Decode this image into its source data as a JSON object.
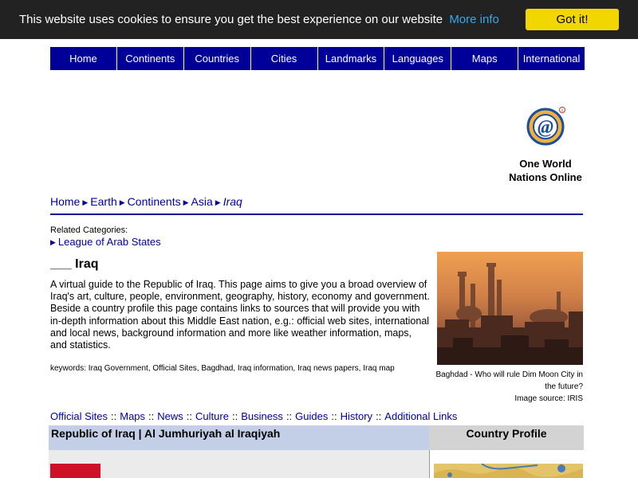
{
  "cookie": {
    "message": "This website uses cookies to ensure you get the best experience on our website",
    "more_info": "More info",
    "button": "Got it!"
  },
  "nav": [
    {
      "label": "Home"
    },
    {
      "label": "Continents"
    },
    {
      "label": "Countries"
    },
    {
      "label": "Cities"
    },
    {
      "label": "Landmarks"
    },
    {
      "label": "Languages"
    },
    {
      "label": "Maps"
    },
    {
      "label": "International"
    }
  ],
  "logo": {
    "line1": "One World",
    "line2": "Nations Online"
  },
  "breadcrumb": {
    "items": [
      "Home",
      "Earth",
      "Continents",
      "Asia"
    ],
    "current": "Iraq"
  },
  "related": {
    "label": "Related Categories:",
    "item": "League of Arab States"
  },
  "page": {
    "title": "___ Iraq",
    "description": "A virtual guide to the Republic of Iraq. This page aims to give you a broad overview of Iraq's art, culture, people, environment, geography, history, economy and government. Beside a country profile this page contains links to sources that will provide you with in-depth information about this Middle East nation, e.g.: official web sites, international and local news, background information and more like weather information, maps, and statistics.",
    "keywords": "keywords: Iraq Government, Official Sites, Bagdhad, Iraq information, Iraq news papers, Iraq map"
  },
  "photo": {
    "caption1": "Baghdad - Who will rule Dim Moon City in the future?",
    "caption2": "Image source: IRIS"
  },
  "section_links": [
    "Official Sites",
    "Maps",
    "News",
    "Culture",
    "Business",
    "Guides",
    "History",
    "Additional Links"
  ],
  "section_sep": "::",
  "table": {
    "left_header": "Republic of Iraq | Al Jumhuriyah al Iraqiyah",
    "right_header": "Country Profile"
  },
  "colors": {
    "nav_bg": "#000099",
    "cookie_bg": "#222222",
    "cookie_button": "#f1d600",
    "link": "#000099"
  }
}
